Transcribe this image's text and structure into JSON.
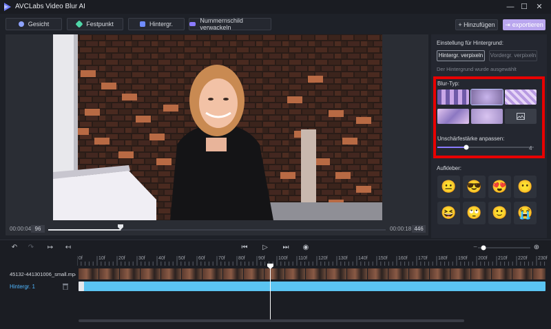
{
  "app": {
    "title": "AVCLabs Video Blur AI"
  },
  "window": {
    "min_icon": "minimize-icon",
    "max_icon": "maximize-icon",
    "close_icon": "close-icon"
  },
  "toolbar": {
    "tabs": [
      {
        "label": "Gesicht",
        "icon": "face-icon",
        "color": "#8ea3ff"
      },
      {
        "label": "Festpunkt",
        "icon": "point-icon",
        "color": "#4fd6a8"
      },
      {
        "label": "Hintergr.",
        "icon": "background-icon",
        "color": "#6f8cff"
      },
      {
        "label": "Nummernschild verwackeln",
        "icon": "license-plate-icon",
        "color": "#8b7bff"
      }
    ],
    "add_label": "+ Hinzufügen",
    "export_label": "exportieren",
    "accent": "#b9a6ee"
  },
  "preview": {
    "time_start": "00:00:04",
    "frame_start": "96",
    "time_end": "00:00:18",
    "frame_end": "446",
    "scrubber_progress": 0.215
  },
  "panel": {
    "heading": "Einstellung für Hintergrund:",
    "mode_background": "Hintergr. verpixeln",
    "mode_foreground": "Vordergr. verpixeln",
    "note": "Der Hintergrund wurde ausgewählt",
    "blur_type_label": "Blur-Typ:",
    "blur_options": [
      "pixelate",
      "gaussian",
      "mosaic",
      "motion",
      "soft",
      "image"
    ],
    "selected_blur": "gaussian",
    "strength_label": "Unschärfestärke anpassen:",
    "strength_value": "4",
    "strength_fraction": 0.3,
    "stickers_label": "Aufkleber:",
    "stickers": [
      "😐",
      "😎",
      "😍",
      "😶",
      "😆",
      "🙄",
      "🙂",
      "😭"
    ]
  },
  "timeline": {
    "ruler_ticks": [
      "0f",
      "10f",
      "20f",
      "30f",
      "40f",
      "50f",
      "60f",
      "70f",
      "80f",
      "90f",
      "100f",
      "110f",
      "120f",
      "130f",
      "140f",
      "150f",
      "160f",
      "170f",
      "180f",
      "190f",
      "200f",
      "210f",
      "220f",
      "230f"
    ],
    "track_name": "45132-441301006_small.mp4",
    "layer_name": "Hintergr. 1",
    "playhead_frame": 96
  }
}
